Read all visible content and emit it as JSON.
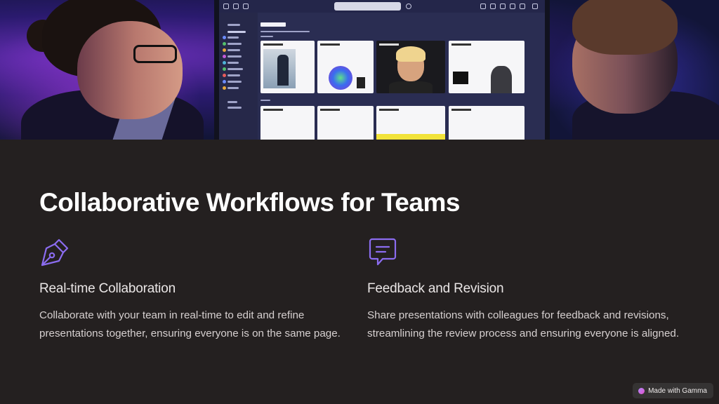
{
  "slide": {
    "title": "Collaborative Workflows for Teams"
  },
  "features": [
    {
      "icon": "pen-nib-icon",
      "heading": "Real-time Collaboration",
      "body": "Collaborate with your team in real-time to edit and refine presentations together, ensuring everyone is on the same page."
    },
    {
      "icon": "chat-bubble-icon",
      "heading": "Feedback and Revision",
      "body": "Share presentations with colleagues for feedback and revisions, streamlining the review process and ensuring everyone is aligned."
    }
  ],
  "badge": {
    "label": "Made with Gamma"
  },
  "colors": {
    "background": "#242020",
    "accent_icon": "#8b6cf0",
    "title": "#ffffff",
    "body_text": "#d6d0d0"
  }
}
